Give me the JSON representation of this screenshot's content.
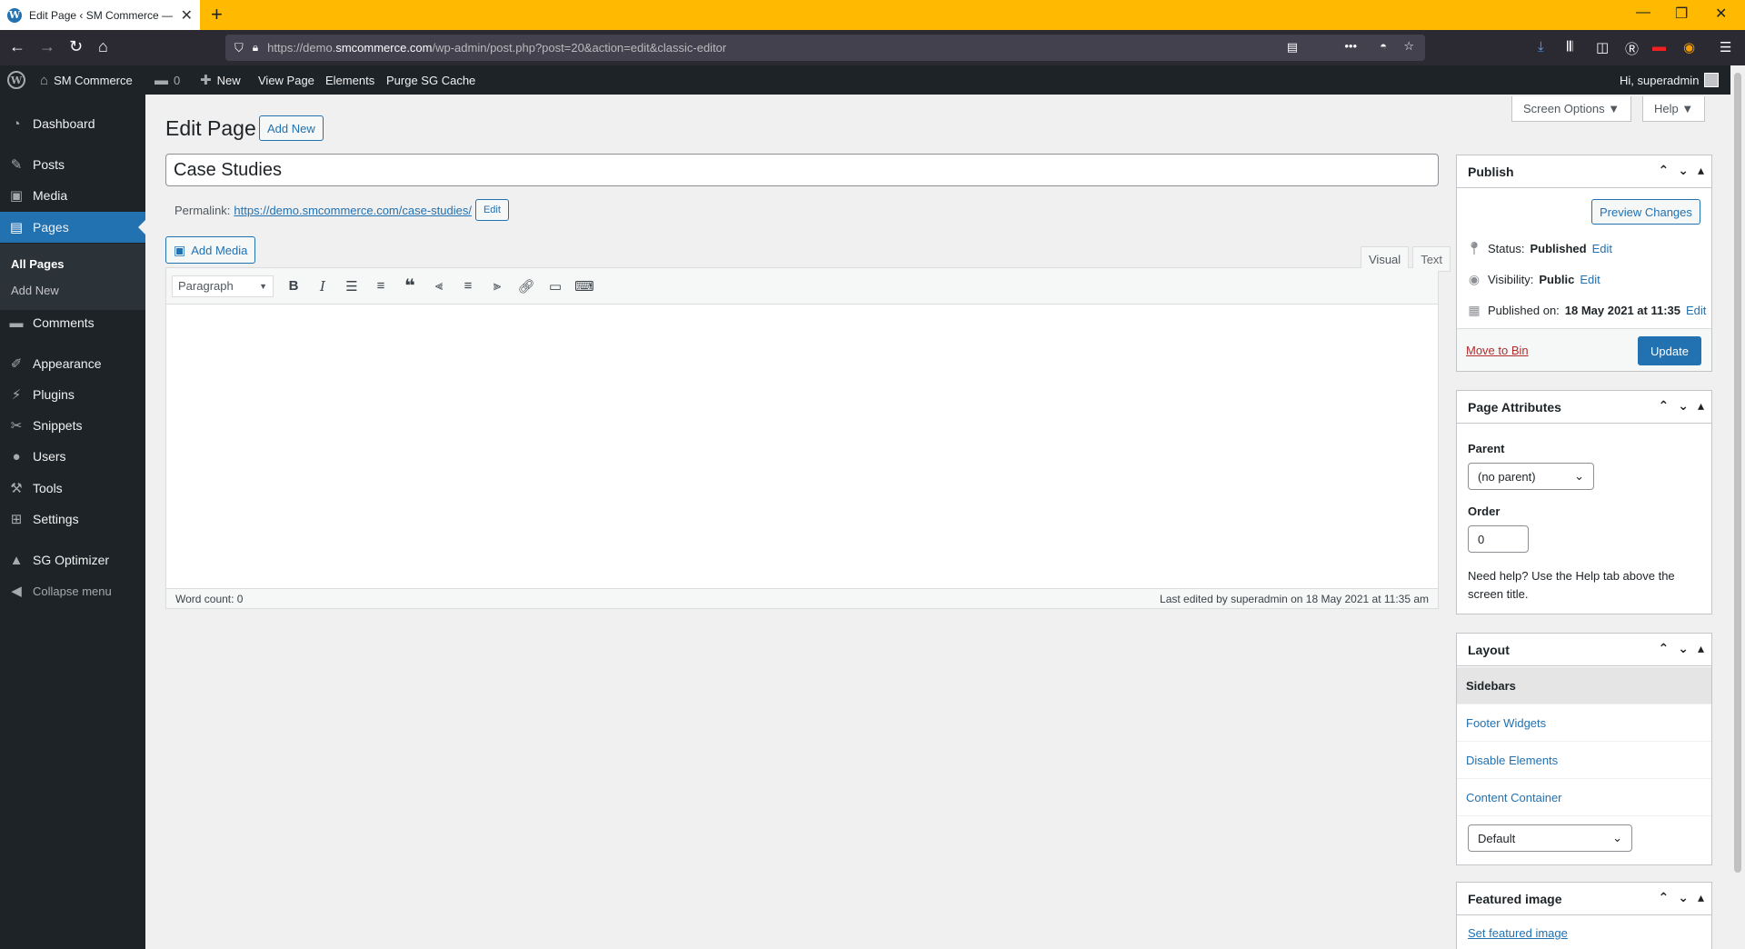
{
  "browser": {
    "tab_title": "Edit Page ‹ SM Commerce — W",
    "tab_favicon": "W",
    "new_tab": "+",
    "url_prefix": "https://demo.",
    "url_domain": "smcommerce.com",
    "url_path": "/wp-admin/post.php?post=20&action=edit&classic-editor",
    "accent": "#ffb900"
  },
  "adminbar": {
    "site_name": "SM Commerce",
    "comments_count": "0",
    "new_label": "New",
    "view_page": "View Page",
    "elements": "Elements",
    "purge": "Purge SG Cache",
    "greeting": "Hi, superadmin"
  },
  "sidebar": {
    "items": [
      {
        "label": "Dashboard",
        "icon": "dashboard-icon",
        "glyph": "◔"
      },
      {
        "label": "Posts",
        "icon": "pin-icon",
        "glyph": "✎"
      },
      {
        "label": "Media",
        "icon": "media-icon",
        "glyph": "▣"
      },
      {
        "label": "Pages",
        "icon": "pages-icon",
        "glyph": "▤"
      },
      {
        "label": "Comments",
        "icon": "comments-icon",
        "glyph": "▬"
      },
      {
        "label": "Appearance",
        "icon": "brush-icon",
        "glyph": "✐"
      },
      {
        "label": "Plugins",
        "icon": "plug-icon",
        "glyph": "⚡"
      },
      {
        "label": "Snippets",
        "icon": "scissors-icon",
        "glyph": "✂"
      },
      {
        "label": "Users",
        "icon": "user-icon",
        "glyph": "●"
      },
      {
        "label": "Tools",
        "icon": "wrench-icon",
        "glyph": "⚒"
      },
      {
        "label": "Settings",
        "icon": "settings-icon",
        "glyph": "⊞"
      },
      {
        "label": "SG Optimizer",
        "icon": "sg-icon",
        "glyph": "▲"
      },
      {
        "label": "Collapse menu",
        "icon": "collapse-icon",
        "glyph": "◀"
      }
    ],
    "sub": {
      "all_pages": "All Pages",
      "add_new": "Add New"
    }
  },
  "header": {
    "title": "Edit Page",
    "add_new": "Add New",
    "screen_options": "Screen Options ▼",
    "help": "Help ▼"
  },
  "post": {
    "title": "Case Studies",
    "permalink_label": "Permalink:",
    "permalink_url": "https://demo.smcommerce.com/case-studies/",
    "permalink_edit": "Edit",
    "add_media": "Add Media"
  },
  "editor": {
    "tab_visual": "Visual",
    "tab_text": "Text",
    "format": "Paragraph",
    "word_count": "Word count: 0",
    "last_edited": "Last edited by superadmin on 18 May 2021 at 11:35 am"
  },
  "publish": {
    "title": "Publish",
    "preview": "Preview Changes",
    "status_label": "Status:",
    "status_value": "Published",
    "visibility_label": "Visibility:",
    "visibility_value": "Public",
    "published_label": "Published on:",
    "published_value": "18 May 2021 at 11:35",
    "edit": "Edit",
    "move_to_bin": "Move to Bin",
    "update": "Update"
  },
  "attributes": {
    "title": "Page Attributes",
    "parent_label": "Parent",
    "parent_value": "(no parent)",
    "order_label": "Order",
    "order_value": "0",
    "help_text": "Need help? Use the Help tab above the screen title."
  },
  "layout": {
    "title": "Layout",
    "tabs": [
      "Sidebars",
      "Footer Widgets",
      "Disable Elements",
      "Content Container"
    ],
    "select_value": "Default"
  },
  "featured": {
    "title": "Featured image",
    "link": "Set featured image"
  }
}
